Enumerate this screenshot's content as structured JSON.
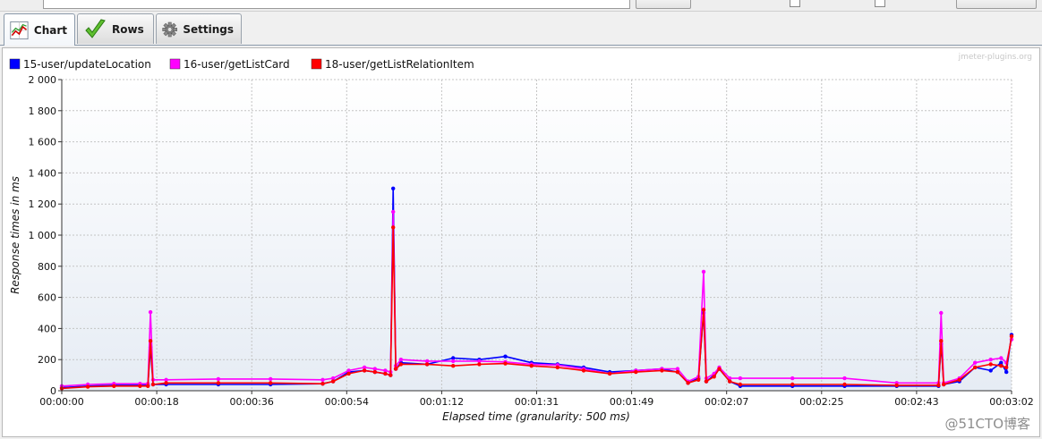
{
  "tabs": [
    {
      "label": "Chart",
      "icon": "chart-icon",
      "active": true
    },
    {
      "label": "Rows",
      "icon": "checkmark-icon",
      "active": false
    },
    {
      "label": "Settings",
      "icon": "gear-icon",
      "active": false
    }
  ],
  "watermark": "jmeter-plugins.org",
  "site_watermark": "@51CTO博客",
  "chart_data": {
    "type": "line",
    "title": "",
    "xlabel": "Elapsed time (granularity: 500 ms)",
    "ylabel": "Response times in ms",
    "ylim": [
      0,
      2000
    ],
    "xlim_seconds": [
      0,
      182
    ],
    "x_tick_labels": [
      "00:00:00",
      "00:00:18",
      "00:00:36",
      "00:00:54",
      "00:01:12",
      "00:01:31",
      "00:01:49",
      "00:02:07",
      "00:02:25",
      "00:02:43",
      "00:03:02"
    ],
    "y_tick_labels": [
      "0",
      "200",
      "400",
      "600",
      "800",
      "1 000",
      "1 200",
      "1 400",
      "1 600",
      "1 800",
      "2 000"
    ],
    "legend_position": "top-left",
    "grid": true,
    "series": [
      {
        "name": "15-user/updateLocation",
        "color": "#0000ff",
        "points": [
          [
            0,
            20
          ],
          [
            5,
            30
          ],
          [
            10,
            35
          ],
          [
            15,
            35
          ],
          [
            16.5,
            35
          ],
          [
            17,
            280
          ],
          [
            17.5,
            40
          ],
          [
            20,
            40
          ],
          [
            30,
            40
          ],
          [
            40,
            40
          ],
          [
            50,
            45
          ],
          [
            52,
            60
          ],
          [
            55,
            120
          ],
          [
            58,
            130
          ],
          [
            60,
            120
          ],
          [
            62,
            110
          ],
          [
            63,
            100
          ],
          [
            63.5,
            1300
          ],
          [
            64,
            140
          ],
          [
            65,
            180
          ],
          [
            70,
            170
          ],
          [
            75,
            210
          ],
          [
            80,
            200
          ],
          [
            85,
            220
          ],
          [
            90,
            180
          ],
          [
            95,
            170
          ],
          [
            100,
            150
          ],
          [
            105,
            120
          ],
          [
            110,
            130
          ],
          [
            115,
            140
          ],
          [
            118,
            120
          ],
          [
            120,
            50
          ],
          [
            122,
            80
          ],
          [
            123,
            500
          ],
          [
            123.5,
            60
          ],
          [
            125,
            100
          ],
          [
            126,
            140
          ],
          [
            128,
            60
          ],
          [
            130,
            30
          ],
          [
            140,
            30
          ],
          [
            150,
            30
          ],
          [
            160,
            30
          ],
          [
            168,
            30
          ],
          [
            168.5,
            300
          ],
          [
            169,
            40
          ],
          [
            172,
            60
          ],
          [
            175,
            150
          ],
          [
            178,
            130
          ],
          [
            180,
            180
          ],
          [
            181,
            120
          ],
          [
            182,
            360
          ]
        ]
      },
      {
        "name": "16-user/getListCard",
        "color": "#ff00ff",
        "points": [
          [
            0,
            30
          ],
          [
            5,
            40
          ],
          [
            10,
            45
          ],
          [
            15,
            45
          ],
          [
            16.5,
            45
          ],
          [
            17,
            505
          ],
          [
            17.5,
            70
          ],
          [
            20,
            70
          ],
          [
            30,
            75
          ],
          [
            40,
            75
          ],
          [
            50,
            70
          ],
          [
            52,
            80
          ],
          [
            55,
            130
          ],
          [
            58,
            150
          ],
          [
            60,
            140
          ],
          [
            62,
            130
          ],
          [
            63,
            120
          ],
          [
            63.5,
            1150
          ],
          [
            64,
            160
          ],
          [
            65,
            200
          ],
          [
            70,
            190
          ],
          [
            75,
            190
          ],
          [
            80,
            190
          ],
          [
            85,
            185
          ],
          [
            90,
            170
          ],
          [
            95,
            165
          ],
          [
            100,
            140
          ],
          [
            105,
            110
          ],
          [
            110,
            130
          ],
          [
            115,
            140
          ],
          [
            118,
            140
          ],
          [
            120,
            60
          ],
          [
            122,
            90
          ],
          [
            123,
            765
          ],
          [
            123.5,
            80
          ],
          [
            125,
            110
          ],
          [
            126,
            150
          ],
          [
            128,
            80
          ],
          [
            130,
            80
          ],
          [
            140,
            80
          ],
          [
            150,
            80
          ],
          [
            160,
            50
          ],
          [
            168,
            50
          ],
          [
            168.5,
            500
          ],
          [
            169,
            50
          ],
          [
            172,
            80
          ],
          [
            175,
            180
          ],
          [
            178,
            200
          ],
          [
            180,
            210
          ],
          [
            181,
            180
          ],
          [
            182,
            330
          ]
        ]
      },
      {
        "name": "18-user/getListRelationItem",
        "color": "#ff0000",
        "points": [
          [
            0,
            15
          ],
          [
            5,
            25
          ],
          [
            10,
            30
          ],
          [
            15,
            30
          ],
          [
            16.5,
            30
          ],
          [
            17,
            320
          ],
          [
            17.5,
            40
          ],
          [
            20,
            50
          ],
          [
            30,
            50
          ],
          [
            40,
            50
          ],
          [
            50,
            45
          ],
          [
            52,
            60
          ],
          [
            55,
            110
          ],
          [
            58,
            130
          ],
          [
            60,
            120
          ],
          [
            62,
            110
          ],
          [
            63,
            100
          ],
          [
            63.5,
            1050
          ],
          [
            64,
            140
          ],
          [
            65,
            170
          ],
          [
            70,
            170
          ],
          [
            75,
            160
          ],
          [
            80,
            170
          ],
          [
            85,
            175
          ],
          [
            90,
            160
          ],
          [
            95,
            150
          ],
          [
            100,
            130
          ],
          [
            105,
            110
          ],
          [
            110,
            120
          ],
          [
            115,
            130
          ],
          [
            118,
            120
          ],
          [
            120,
            50
          ],
          [
            122,
            70
          ],
          [
            123,
            520
          ],
          [
            123.5,
            60
          ],
          [
            125,
            90
          ],
          [
            126,
            140
          ],
          [
            128,
            60
          ],
          [
            130,
            40
          ],
          [
            140,
            40
          ],
          [
            150,
            40
          ],
          [
            160,
            35
          ],
          [
            168,
            35
          ],
          [
            168.5,
            320
          ],
          [
            169,
            40
          ],
          [
            172,
            70
          ],
          [
            175,
            150
          ],
          [
            178,
            170
          ],
          [
            180,
            160
          ],
          [
            181,
            150
          ],
          [
            182,
            350
          ]
        ]
      }
    ]
  }
}
